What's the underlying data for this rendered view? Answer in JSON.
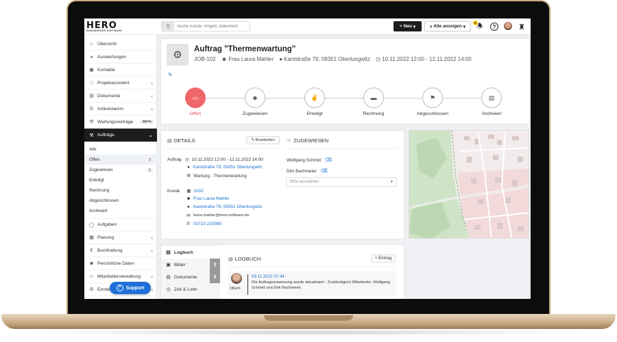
{
  "brand": {
    "logo": "HERO",
    "tagline": "HANDWERKER SOFTWARE"
  },
  "topbar": {
    "search_placeholder": "Suche Kunde, Projekt, Dokument",
    "new_label": "Neu",
    "show_all_label": "Alle anzeigen",
    "notification_count": "0"
  },
  "sidebar": {
    "items": [
      {
        "label": "Übersicht",
        "icon": "home-icon"
      },
      {
        "label": "Auswertungen",
        "icon": "pie-chart-icon"
      },
      {
        "label": "Kontakte",
        "icon": "contacts-icon"
      },
      {
        "label": "Projektassistent",
        "icon": "folder-icon"
      },
      {
        "label": "Dokumente",
        "icon": "document-icon"
      },
      {
        "label": "Artikelstamm",
        "icon": "list-icon"
      },
      {
        "label": "Wartungsverträge",
        "icon": "wrench-icon",
        "tag": "BETA"
      },
      {
        "label": "Aufträge",
        "icon": "hammer-icon"
      }
    ],
    "subitems": [
      {
        "label": "Alle",
        "count": ""
      },
      {
        "label": "Offen",
        "count": "3"
      },
      {
        "label": "Zugewiesen",
        "count": "1"
      },
      {
        "label": "Erledigt",
        "count": ""
      },
      {
        "label": "Rechnung",
        "count": ""
      },
      {
        "label": "Abgeschlossen",
        "count": ""
      },
      {
        "label": "Archiviert",
        "count": ""
      }
    ],
    "lower": [
      {
        "label": "Aufgaben",
        "icon": "check-circle-icon"
      },
      {
        "label": "Planung",
        "icon": "calendar-icon"
      },
      {
        "label": "Buchhaltung",
        "icon": "euro-icon"
      },
      {
        "label": "Persönliche Daten",
        "icon": "user-icon"
      },
      {
        "label": "Mitarbeiterverwaltung",
        "icon": "team-icon"
      },
      {
        "label": "Einstellungen",
        "icon": "gear-icon"
      }
    ],
    "support_label": "Support"
  },
  "job": {
    "title": "Auftrag \"Thermenwartung\"",
    "id": "JOB-102",
    "customer": "Frau Laura Mahler",
    "address": "Kantstraße 79, 09351 Oberlungwitz",
    "period": "10.11.2022 12:00 - 12.11.2022 14:00"
  },
  "steps": [
    {
      "label": "Offen",
      "active": true
    },
    {
      "label": "Zugewiesen",
      "active": false
    },
    {
      "label": "Erledigt",
      "active": false
    },
    {
      "label": "Rechnung",
      "active": false
    },
    {
      "label": "Abgeschlossen",
      "active": false
    },
    {
      "label": "Archiviert",
      "active": false
    }
  ],
  "details": {
    "heading": "DETAILS",
    "edit_label": "Bearbeiten",
    "auftrag_label": "Auftrag",
    "auftrag_period": "10.11.2022 12:00 - 12.11.2022 14:00",
    "auftrag_address": "Kantstraße 79, 09351 Oberlungwitz",
    "auftrag_type": "Wartung - Thermenwartung",
    "kunde_label": "Kunde",
    "kunde_number": "1002",
    "kunde_name": "Frau Laura Mahler",
    "kunde_address": "Kantstraße 79, 09351 Oberlungwitz",
    "kunde_email": "laura.mahler@hero-software.de",
    "kunde_phone": "03723 229389"
  },
  "assigned": {
    "heading": "ZUGEWIESEN",
    "people": [
      "Wolfgang Schmid",
      "Dirk Bachmeier"
    ],
    "select_placeholder": "Bitte auswählen"
  },
  "logbook": {
    "tabs": [
      {
        "label": "Logbuch",
        "count": ""
      },
      {
        "label": "Bilder",
        "count": "3"
      },
      {
        "label": "Dokumente",
        "count": "3"
      },
      {
        "label": "Zeit & Lohn",
        "count": ""
      }
    ],
    "heading": "LOGBUCH",
    "add_label": "Eintrag",
    "entry": {
      "author": "DBach",
      "date": "09.11.2022 07:44",
      "text": "Die Auftragszuweisung wurde aktualisiert - Zuständige(r) Mitarbeiter: Wolfgang Schmid und Dirk Bachmeier."
    }
  },
  "colors": {
    "accent": "#f0676a",
    "link": "#1a6fd1",
    "primary_dark": "#1d1d1d",
    "support": "#1f6fd8"
  }
}
